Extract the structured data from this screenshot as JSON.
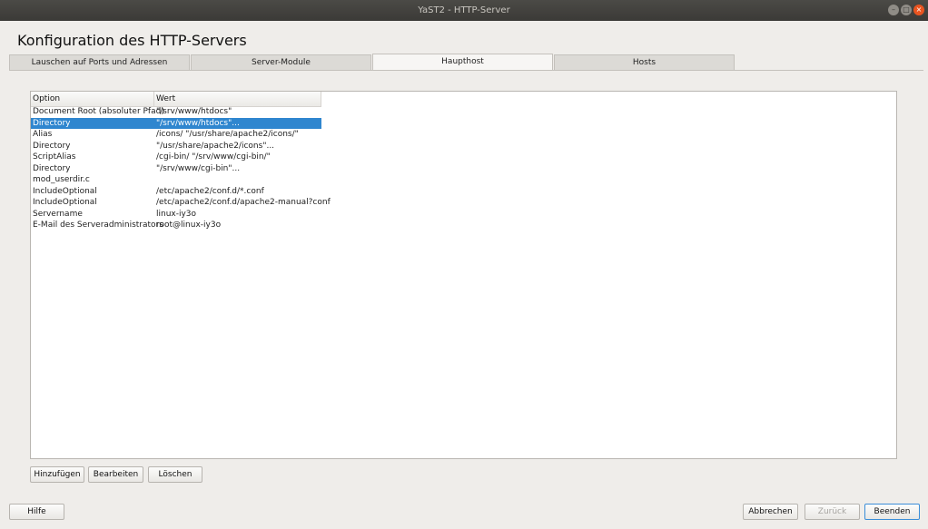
{
  "window": {
    "title": "YaST2 - HTTP-Server"
  },
  "header": {
    "title": "Konfiguration des HTTP-Servers"
  },
  "tabs": [
    {
      "label": "Lauschen auf Ports und Adressen"
    },
    {
      "label": "Server-Module"
    },
    {
      "label": "Haupthost"
    },
    {
      "label": "Hosts"
    }
  ],
  "table": {
    "columns": [
      "Option",
      "Wert"
    ],
    "rows": [
      {
        "option": "Document Root (absoluter Pfad)",
        "value": "\"/srv/www/htdocs\""
      },
      {
        "option": "Directory",
        "value": "\"/srv/www/htdocs\"..."
      },
      {
        "option": "Alias",
        "value": "/icons/ \"/usr/share/apache2/icons/\""
      },
      {
        "option": "Directory",
        "value": "\"/usr/share/apache2/icons\"..."
      },
      {
        "option": "ScriptAlias",
        "value": "/cgi-bin/ \"/srv/www/cgi-bin/\""
      },
      {
        "option": "Directory",
        "value": "\"/srv/www/cgi-bin\"..."
      },
      {
        "option": "mod_userdir.c",
        "value": ""
      },
      {
        "option": "IncludeOptional",
        "value": "/etc/apache2/conf.d/*.conf"
      },
      {
        "option": "IncludeOptional",
        "value": "/etc/apache2/conf.d/apache2-manual?conf"
      },
      {
        "option": "Servername",
        "value": "linux-iy3o"
      },
      {
        "option": "E-Mail des Serveradministrators",
        "value": "root@linux-iy3o"
      }
    ]
  },
  "actions": {
    "add": "Hinzufügen",
    "edit": "Bearbeiten",
    "delete": "Löschen"
  },
  "footer": {
    "help": "Hilfe",
    "cancel": "Abbrechen",
    "back": "Zurück",
    "finish": "Beenden"
  }
}
